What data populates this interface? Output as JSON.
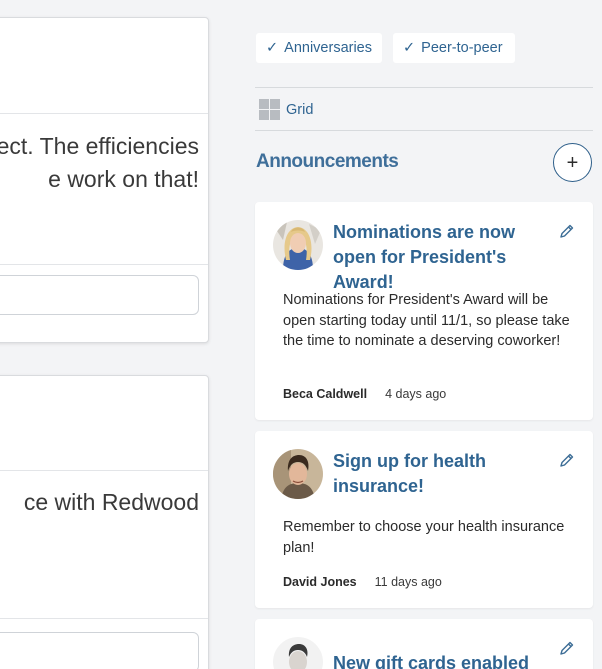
{
  "feed": {
    "posts": [
      {
        "text_lines": [
          "ect. The efficiencies",
          "e work on that!"
        ]
      },
      {
        "text_lines": [
          "ce with Redwood"
        ]
      }
    ]
  },
  "filters": {
    "tags": [
      {
        "label": "Anniversaries",
        "check": "✓"
      },
      {
        "label": "Peer-to-peer",
        "check": "✓"
      }
    ],
    "view": {
      "label": "Grid",
      "icon": "grid-icon"
    }
  },
  "announcements": {
    "title": "Announcements",
    "add_label": "+",
    "items": [
      {
        "title": "Nominations are now open for President's Award!",
        "body": "Nominations for President's Award will be open starting today until 11/1, so please take the time to nominate a deserving coworker!",
        "author": "Beca Caldwell",
        "time": "4 days ago"
      },
      {
        "title": "Sign up for health insurance!",
        "body": "Remember to choose your health insurance plan!",
        "author": "David Jones",
        "time": "11 days ago"
      },
      {
        "title": "New gift cards enabled"
      }
    ]
  },
  "colors": {
    "accent": "#2f6491",
    "section_title": "#3f6f9a",
    "background": "#f3f4f6"
  }
}
